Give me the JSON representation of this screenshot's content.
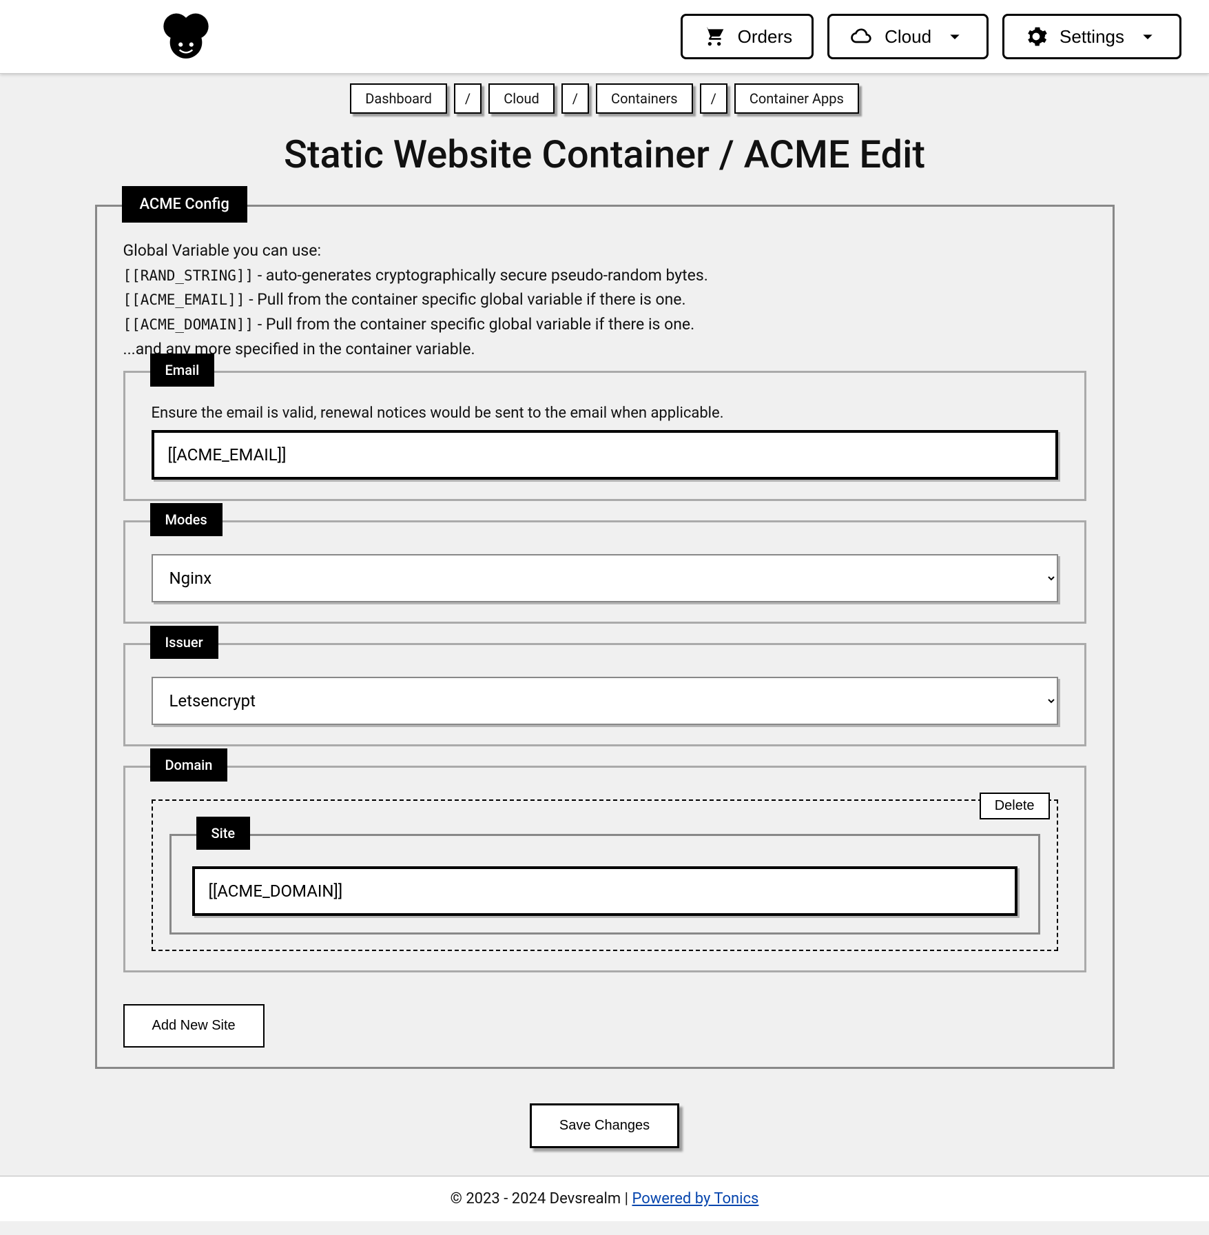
{
  "nav": {
    "orders": "Orders",
    "cloud": "Cloud",
    "settings": "Settings"
  },
  "breadcrumbs": {
    "items": [
      "Dashboard",
      "Cloud",
      "Containers",
      "Container Apps"
    ],
    "sep": "/"
  },
  "page_title": "Static Website Container / ACME Edit",
  "acme": {
    "legend": "ACME Config",
    "info_intro": "Global Variable you can use:",
    "var1_code": "[[RAND_STRING]]",
    "var1_desc": " - auto-generates cryptographically secure pseudo-random bytes.",
    "var2_code": "[[ACME_EMAIL]]",
    "var2_desc": " - Pull from the container specific global variable if there is one.",
    "var3_code": "[[ACME_DOMAIN]]",
    "var3_desc": " - Pull from the container specific global variable if there is one.",
    "info_outro": "...and any more specified in the container variable."
  },
  "email": {
    "legend": "Email",
    "hint": "Ensure the email is valid, renewal notices would be sent to the email when applicable.",
    "value": "[[ACME_EMAIL]]"
  },
  "modes": {
    "legend": "Modes",
    "selected": "Nginx"
  },
  "issuer": {
    "legend": "Issuer",
    "selected": "Letsencrypt"
  },
  "domain": {
    "legend": "Domain",
    "delete_label": "Delete",
    "site_legend": "Site",
    "site_value": "[[ACME_DOMAIN]]",
    "add_label": "Add New Site"
  },
  "save_label": "Save Changes",
  "footer": {
    "copyright": "© 2023 - 2024 Devsrealm | ",
    "link_text": "Powered by Tonics"
  }
}
